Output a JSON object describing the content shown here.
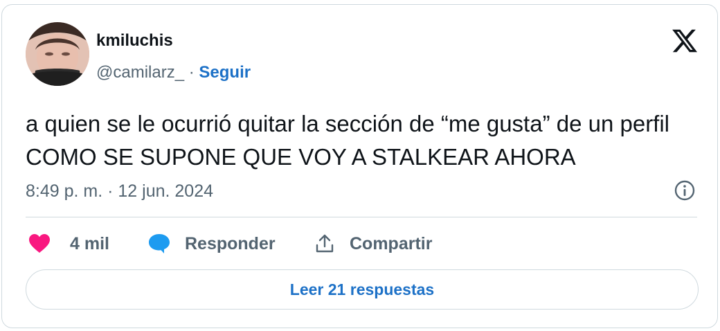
{
  "tweet": {
    "author": {
      "display_name": "kmiluchis",
      "handle": "@camilarz_",
      "separator": " · ",
      "follow_label": "Seguir"
    },
    "text": "a quien se le ocurrió quitar la sección de “me gusta” de un perfil COMO SE SUPONE QUE VOY A STALKEAR AHORA",
    "timestamp": "8:49 p. m. · 12 jun. 2024",
    "actions": {
      "likes": "4 mil",
      "reply_label": "Responder",
      "share_label": "Compartir"
    },
    "read_replies_label": "Leer 21 respuestas"
  },
  "colors": {
    "like": "#f91880",
    "reply": "#1d9bf0",
    "link": "#1d71c7",
    "muted": "#536471",
    "text": "#0f1419",
    "border": "#cfd9de"
  },
  "icons": {
    "brand": "x-logo-icon",
    "info": "info-circle-icon",
    "like": "heart-icon",
    "reply": "speech-bubble-icon",
    "share": "share-upload-icon"
  }
}
